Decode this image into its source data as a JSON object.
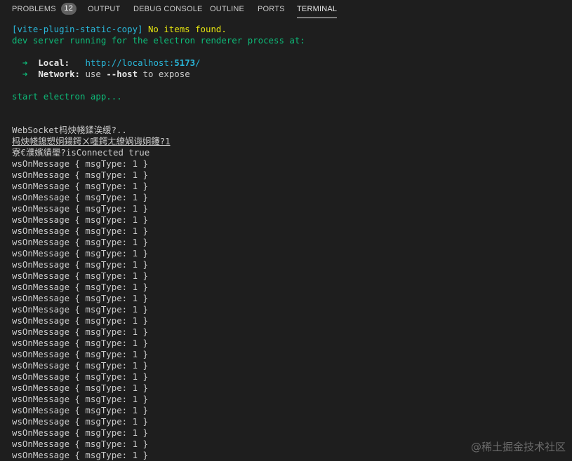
{
  "tabs": [
    {
      "label": "PROBLEMS",
      "badge": "12",
      "active": false
    },
    {
      "label": "OUTPUT",
      "active": false
    },
    {
      "label": "DEBUG CONSOLE",
      "active": false
    },
    {
      "label": "OUTLINE",
      "active": false
    },
    {
      "label": "PORTS",
      "active": false
    },
    {
      "label": "TERMINAL",
      "active": true
    }
  ],
  "terminal": {
    "plugin_tag": "[vite-plugin-static-copy]",
    "plugin_msg": " No items found.",
    "dev_server": "dev server running for the electron renderer process at:",
    "arrow": "➜",
    "local_label": "Local:",
    "local_url_prefix": "http://localhost:",
    "local_port": "5173",
    "local_url_suffix": "/",
    "network_label": "Network:",
    "network_use": "use ",
    "network_flag": "--host",
    "network_rest": " to expose",
    "start_app": "start electron app...",
    "garbled_1": "WebSocket杩炴帴鍒涘缓?..",
    "garbled_2": "杩炴帴鎴愬姛鍚鍔ㄨ嚜鍔ㄤ繚娲诲姛鑳?1",
    "garbled_3": "寮€濮嬪績璺?isConnected true",
    "ws_message": "wsOnMessage { msgType: 1 }",
    "ws_repeat_count": 27
  },
  "watermark": "@稀土掘金技术社区",
  "colors": {
    "background": "#1e1e1e",
    "text": "#cccccc",
    "cyan": "#29b8db",
    "yellow": "#e5e510",
    "green": "#0dbc79",
    "badge": "#616161"
  }
}
